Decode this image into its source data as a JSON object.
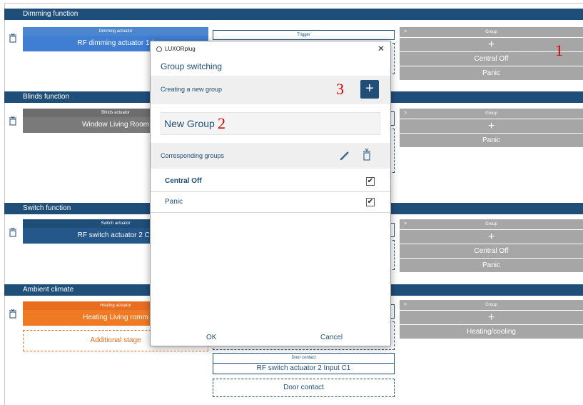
{
  "sections": [
    {
      "title": "Dimming function"
    },
    {
      "title": "Blinds function"
    },
    {
      "title": "Switch function"
    },
    {
      "title": "Ambient climate"
    }
  ],
  "actuators": {
    "dimming": {
      "head": "Dimming actuator",
      "name": "RF dimming actuator 1 ("
    },
    "blinds": {
      "head": "Blinds actuator",
      "name": "Window Living Room"
    },
    "switch": {
      "head": "Switch actuator",
      "name": "RF switch actuator 2 C1"
    },
    "heating": {
      "head": "Heating actuator",
      "name": "Heating Living romm"
    },
    "additional_stage": "Additional stage"
  },
  "middle": {
    "trigger_head": "Trigger",
    "door_contact_head": "Door contact",
    "door_contact_name": "RF switch actuator 2 Input C1",
    "door_contact_add": "Door contact"
  },
  "group_panels": [
    {
      "arrow": ">",
      "head": "Group",
      "rows": [
        "+",
        "Central Off",
        "Panic"
      ]
    },
    {
      "arrow": ">",
      "head": "Group",
      "rows": [
        "+",
        "Panic"
      ]
    },
    {
      "arrow": ">",
      "head": "Group",
      "rows": [
        "+",
        "Central Off",
        "Panic"
      ]
    },
    {
      "arrow": ">",
      "head": "Group",
      "rows": [
        "+",
        "Heating/cooling"
      ]
    }
  ],
  "annotations": {
    "one": "1",
    "two": "2",
    "three": "3"
  },
  "dialog": {
    "app_title": "LUXORplug",
    "close": "✕",
    "heading": "Group switching",
    "create_label": "Creating a new group",
    "plus": "+",
    "name_value": "New Group",
    "corresponding_label": "Corresponding groups",
    "groups": [
      {
        "label": "Central Off",
        "checked": "✔"
      },
      {
        "label": "Panic",
        "checked": "✔"
      }
    ],
    "ok": "OK",
    "cancel": "Cancel"
  },
  "colors": {
    "navy": "#1f4e79",
    "blue": "#3f7ed3",
    "gray": "#7a7a7a",
    "orange": "#f07a24",
    "red": "#d40000"
  }
}
